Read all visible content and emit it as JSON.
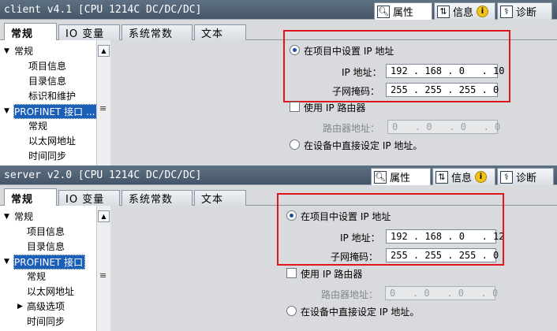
{
  "panels": [
    {
      "title": "client v4.1 [CPU 1214C DC/DC/DC]",
      "inspector_tabs": [
        {
          "label": "属性",
          "icon": "properties-icon"
        },
        {
          "label": "信息",
          "icon": "info-icon",
          "badge": "i"
        },
        {
          "label": "诊断",
          "icon": "diagnostics-icon"
        }
      ],
      "tabs": [
        "常规",
        "IO 变量",
        "系统常数",
        "文本"
      ],
      "nav": [
        {
          "label": "常规",
          "arrow": "▼"
        },
        {
          "label": "项目信息"
        },
        {
          "label": "目录信息"
        },
        {
          "label": "标识和维护"
        },
        {
          "label": "PROFINET 接口 ...",
          "arrow": "▼"
        },
        {
          "label": "常规"
        },
        {
          "label": "以太网地址"
        },
        {
          "label": "时间同步"
        }
      ],
      "form": {
        "set_in_project": "在项目中设置 IP 地址",
        "ip_label": "IP 地址：",
        "ip_value": "192 . 168 . 0   . 10",
        "mask_label": "子网掩码：",
        "mask_value": "255 . 255 . 255 . 0",
        "use_router": "使用 IP 路由器",
        "router_label": "路由器地址：",
        "router_value": "0   . 0   . 0   . 0",
        "set_on_device": "在设备中直接设定 IP 地址。"
      }
    },
    {
      "title": "server v2.0 [CPU 1214C DC/DC/DC]",
      "inspector_tabs": [
        {
          "label": "属性",
          "icon": "properties-icon"
        },
        {
          "label": "信息",
          "icon": "info-icon",
          "badge": "i"
        },
        {
          "label": "诊断",
          "icon": "diagnostics-icon"
        }
      ],
      "tabs": [
        "常规",
        "IO 变量",
        "系统常数",
        "文本"
      ],
      "nav": [
        {
          "label": "常规",
          "arrow": "▼"
        },
        {
          "label": "项目信息"
        },
        {
          "label": "目录信息"
        },
        {
          "label": "PROFINET 接口",
          "arrow": "▼"
        },
        {
          "label": "常规"
        },
        {
          "label": "以太网地址"
        },
        {
          "label": "高级选项",
          "arrow": "▶"
        },
        {
          "label": "时间同步"
        }
      ],
      "form": {
        "set_in_project": "在项目中设置 IP 地址",
        "ip_label": "IP 地址：",
        "ip_value": "192 . 168 . 0   . 12",
        "mask_label": "子网掩码：",
        "mask_value": "255 . 255 . 255 . 0",
        "use_router": "使用 IP 路由器",
        "router_label": "路由器地址：",
        "router_value": "0   . 0   . 0   . 0",
        "set_on_device": "在设备中直接设定 IP 地址。"
      }
    }
  ],
  "colors": {
    "highlight": "#e0151d",
    "titlebar": "#4e6074",
    "selection": "#1c5fb8"
  }
}
